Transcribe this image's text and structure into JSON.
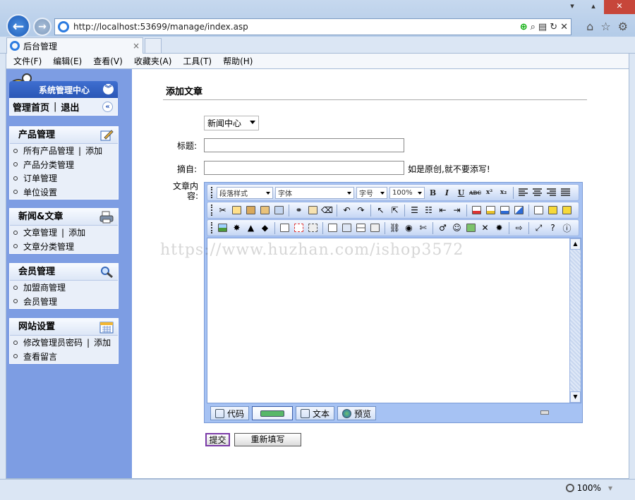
{
  "browser": {
    "url": "http://localhost:53699/manage/index.asp",
    "tab_title": "后台管理",
    "tab_close": "×",
    "menu": [
      "文件(F)",
      "编辑(E)",
      "查看(V)",
      "收藏夹(A)",
      "工具(T)",
      "帮助(H)"
    ],
    "zoom": "100%"
  },
  "sidebar": {
    "title": "系统管理中心",
    "home": "管理首页",
    "sep": "|",
    "logout": "退出",
    "sections": [
      {
        "title": "产品管理",
        "items": [
          {
            "label": "所有产品管理",
            "extra": "添加"
          },
          {
            "label": "产品分类管理"
          },
          {
            "label": "订单管理"
          },
          {
            "label": "单位设置"
          }
        ]
      },
      {
        "title": "新闻&文章",
        "items": [
          {
            "label": "文章管理",
            "extra": "添加"
          },
          {
            "label": "文章分类管理"
          }
        ]
      },
      {
        "title": "会员管理",
        "items": [
          {
            "label": "加盟商管理"
          },
          {
            "label": "会员管理"
          }
        ]
      },
      {
        "title": "网站设置",
        "items": [
          {
            "label": "修改管理员密码",
            "extra": "添加"
          },
          {
            "label": "查看留言"
          }
        ]
      }
    ]
  },
  "form": {
    "page_title": "添加文章",
    "category_selected": "新闻中心",
    "title_label": "标题:",
    "excerpt_label": "摘自:",
    "excerpt_hint": "如是原创,就不要添写!",
    "content_label": "文章内容:",
    "editor": {
      "style_dropdown": "段落样式",
      "font_dropdown": "字体",
      "size_dropdown": "字号",
      "zoom_dropdown": "100%",
      "bold": "B",
      "italic": "I",
      "underline": "U",
      "strike": "ABC",
      "superscript": "x²",
      "subscript": "x₂",
      "modes": [
        "代码",
        "文本",
        "预览"
      ]
    },
    "submit_label": "提交",
    "reset_label": "重新填写"
  },
  "watermark": "https://www.huzhan.com/ishop3572"
}
